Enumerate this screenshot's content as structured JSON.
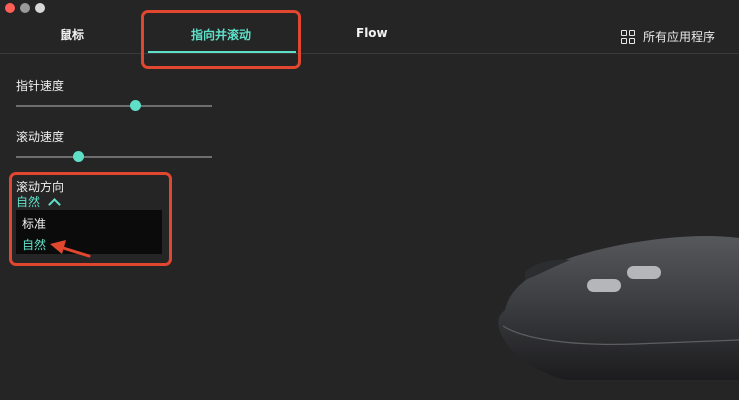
{
  "window": {
    "controls": [
      "close",
      "minimize",
      "zoom"
    ]
  },
  "tabs": [
    {
      "label": "鼠标",
      "active": false
    },
    {
      "label": "指向并滚动",
      "active": true
    },
    {
      "label": "Flow",
      "active": false
    }
  ],
  "all_apps": {
    "label": "所有应用程序",
    "icon": "grid-icon"
  },
  "settings": {
    "pointer_speed": {
      "label": "指针速度",
      "value": 0.61
    },
    "scroll_speed": {
      "label": "滚动速度",
      "value": 0.32
    },
    "scroll_direction": {
      "label": "滚动方向",
      "selected": "自然",
      "options": [
        "标准",
        "自然"
      ]
    }
  },
  "colors": {
    "accent": "#5ee0c8",
    "highlight": "#e0472e",
    "background": "#252525"
  }
}
